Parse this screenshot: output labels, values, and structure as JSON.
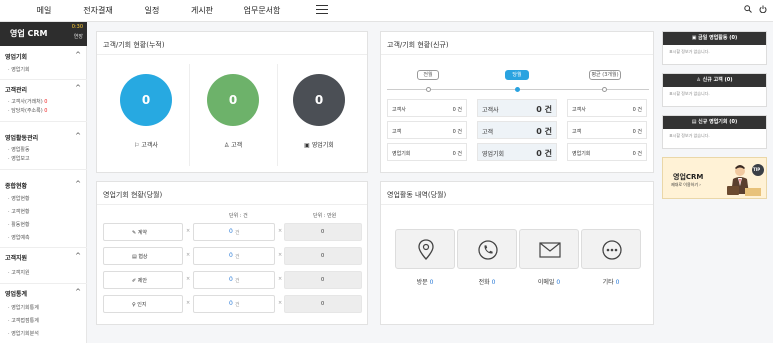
{
  "topnav": {
    "items": [
      "메일",
      "전자결재",
      "일정",
      "게시판",
      "업무문서함"
    ]
  },
  "sidebar": {
    "brand": "영업 CRM",
    "time": "0:30",
    "sub": "연장",
    "sections": [
      {
        "title": "영업기회",
        "items": [
          "영업기회"
        ]
      },
      {
        "title": "고객관리",
        "items": [
          "고객사(거래처)",
          "담당자(주소록)"
        ]
      },
      {
        "title": "영업활동관리",
        "items": [
          "영업활동",
          "영업보고"
        ]
      },
      {
        "title": "종합현황",
        "items": [
          "영업현황",
          "고객현황",
          "활동현황",
          "영업예측"
        ]
      },
      {
        "title": "고객지원",
        "items": [
          "고객지원"
        ]
      },
      {
        "title": "영업통계",
        "items": [
          "영업기회통계",
          "고객접점통계",
          "영업기회분석"
        ]
      }
    ],
    "red_badges": [
      "0",
      "0"
    ]
  },
  "panels": {
    "cumulative": {
      "title": "고객/기회 현황(누적)",
      "items": [
        {
          "value": "0",
          "label": "고객사",
          "color": "#27a9e1"
        },
        {
          "value": "0",
          "label": "고객",
          "color": "#6db26a"
        },
        {
          "value": "0",
          "label": "영업기회",
          "color": "#4b4f55"
        }
      ]
    },
    "new": {
      "title": "고객/기회 현황(신규)",
      "timeline": [
        "전월",
        "당월",
        "평균 (3개월)"
      ],
      "columns": [
        [
          {
            "k": "고객사",
            "v": "0 건"
          },
          {
            "k": "고객",
            "v": "0 건"
          },
          {
            "k": "영업기회",
            "v": "0 건"
          }
        ],
        [
          {
            "k": "고객사",
            "v": "0 건"
          },
          {
            "k": "고객",
            "v": "0 건"
          },
          {
            "k": "영업기회",
            "v": "0 건"
          }
        ],
        [
          {
            "k": "고객사",
            "v": "0 건"
          },
          {
            "k": "고객",
            "v": "0 건"
          },
          {
            "k": "영업기회",
            "v": "0 건"
          }
        ]
      ]
    },
    "monthly": {
      "title": "영업기회 현황(당월)",
      "unit_count": "단위 : 건",
      "unit_amount": "단위 : 만원",
      "rows": [
        {
          "label": "계약",
          "count": "0",
          "count_unit": "건",
          "amount": "0"
        },
        {
          "label": "협상",
          "count": "0",
          "count_unit": "건",
          "amount": "0"
        },
        {
          "label": "제안",
          "count": "0",
          "count_unit": "건",
          "amount": "0"
        },
        {
          "label": "인지",
          "count": "0",
          "count_unit": "건",
          "amount": "0"
        }
      ],
      "x_mark": "×"
    },
    "activity": {
      "title": "영업활동 내역(당월)",
      "items": [
        {
          "label": "방문",
          "value": "0",
          "icon": "location-pin-icon"
        },
        {
          "label": "전화",
          "value": "0",
          "icon": "phone-icon"
        },
        {
          "label": "이메일",
          "value": "0",
          "icon": "mail-icon"
        },
        {
          "label": "기타",
          "value": "0",
          "icon": "more-icon"
        }
      ]
    }
  },
  "right": {
    "boxes": [
      {
        "title": "금일 영업활동 (0)",
        "body": "표시할 정보가 없습니다."
      },
      {
        "title": "신규 고객 (0)",
        "body": "표시할 정보가 없습니다."
      },
      {
        "title": "신규 영업기회 (0)",
        "body": "표시할 정보가 없습니다."
      }
    ],
    "banner": {
      "title": "영업CRM",
      "sub": "제대로 이용하기 ›",
      "tip": "TIP"
    }
  }
}
